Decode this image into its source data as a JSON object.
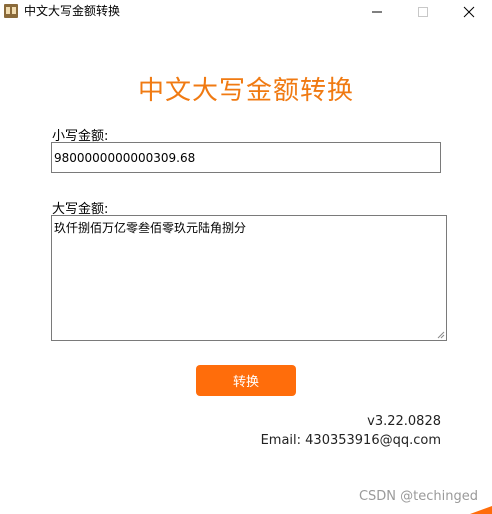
{
  "window": {
    "title": "中文大写金额转换"
  },
  "heading": "中文大写金额转换",
  "small_amount": {
    "label": "小写金额:",
    "value": "9800000000000309.68"
  },
  "big_amount": {
    "label": "大写金额:",
    "value": "玖仟捌佰万亿零叁佰零玖元陆角捌分"
  },
  "convert_button": {
    "label": "转换"
  },
  "footer": {
    "version": "v3.22.0828",
    "email": "Email: 430353916@qq.com"
  },
  "watermark": "CSDN @techinged",
  "colors": {
    "accent": "#ff6d0b",
    "heading": "#f07a12"
  }
}
